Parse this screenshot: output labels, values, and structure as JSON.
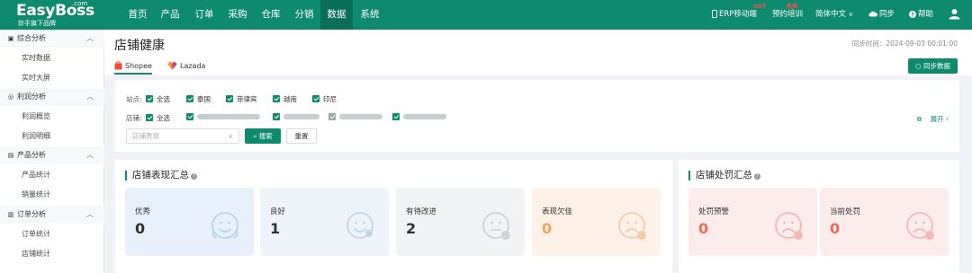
{
  "brand": {
    "name": "EasyBoss",
    "domain": ".com",
    "tagline": "妙手旗下品牌"
  },
  "colors": {
    "primary": "#0e8a6f",
    "nav_active": "#0a6e58",
    "hot_badge": "#ff4d4f"
  },
  "nav": {
    "items": [
      "首页",
      "产品",
      "订单",
      "采购",
      "仓库",
      "分销",
      "数据",
      "系统"
    ],
    "active": "数据"
  },
  "top_right": {
    "erp_mobile": "ERP移动端",
    "erp_badge": "HOT",
    "training": "预约培训",
    "training_badge": "热推",
    "language": "简体中文",
    "sync": "同步",
    "help": "帮助"
  },
  "sidebar": {
    "groups": [
      {
        "title": "综合分析",
        "icon": "dashboard-icon",
        "items": [
          "实时数据",
          "实时大屏"
        ]
      },
      {
        "title": "利润分析",
        "icon": "profit-icon",
        "items": [
          "利润概览",
          "利润明细"
        ]
      },
      {
        "title": "产品分析",
        "icon": "product-icon",
        "items": [
          "产品统计",
          "销量统计"
        ]
      },
      {
        "title": "订单分析",
        "icon": "order-icon",
        "items": [
          "订单统计",
          "店铺统计"
        ]
      }
    ]
  },
  "header": {
    "title": "店铺健康",
    "sync_time": "同步时间：2024-09-03 00:01:00",
    "tabs": [
      {
        "label": "Shopee",
        "icon": "shopee-icon",
        "active": true
      },
      {
        "label": "Lazada",
        "icon": "lazada-icon",
        "active": false
      }
    ],
    "sync_button": "同步数据"
  },
  "filter": {
    "site_label": "站点:",
    "sites": [
      "全选",
      "泰国",
      "菲律宾",
      "越南",
      "印尼"
    ],
    "store_label": "店铺:",
    "store_all": "全选",
    "expand": "展开",
    "select_placeholder": "店铺表现",
    "search_button": "搜索",
    "reset_button": "重置"
  },
  "performance": {
    "title": "店铺表现汇总",
    "cards": [
      {
        "label": "优秀",
        "value": "0",
        "face": "happy-face-icon",
        "bg": "#e8f1fb",
        "value_color": "#333333",
        "icon_color": "#b6d2ec"
      },
      {
        "label": "良好",
        "value": "1",
        "face": "smile-face-icon",
        "bg": "#eef4fa",
        "value_color": "#333333",
        "icon_color": "#c2d6e8"
      },
      {
        "label": "有待改进",
        "value": "2",
        "face": "neutral-face-icon",
        "bg": "#f1f3f5",
        "value_color": "#333333",
        "icon_color": "#cdd3d9"
      },
      {
        "label": "表现欠佳",
        "value": "0",
        "face": "sad-face-icon",
        "bg": "#fdf1e8",
        "value_color": "#f5a15a",
        "icon_color": "#f5cba8"
      }
    ]
  },
  "penalty": {
    "title": "店铺处罚汇总",
    "cards": [
      {
        "label": "处罚预警",
        "value": "0",
        "face": "warning-face-icon",
        "bg": "#fdecec",
        "value_color": "#f06a5a",
        "icon_color": "#f4b9b4"
      },
      {
        "label": "当前处罚",
        "value": "0",
        "face": "penalty-face-icon",
        "bg": "#fdecec",
        "value_color": "#f06a5a",
        "icon_color": "#f4b9b4"
      }
    ]
  }
}
